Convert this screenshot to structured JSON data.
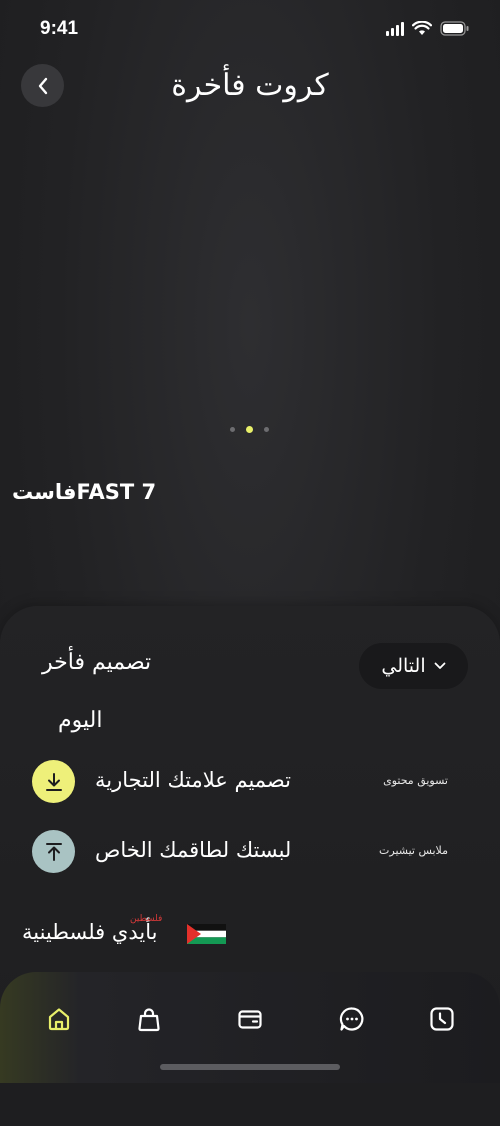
{
  "status_bar": {
    "time": "9:41"
  },
  "header": {
    "title": "كروت فأخرة"
  },
  "carousel": {
    "car_name": "فاستFAST 7"
  },
  "sheet": {
    "title": "تصميم فأخر",
    "next_label": "التالي",
    "date_label": "اليوم",
    "rows": [
      {
        "label": "تصميم علامتك التجارية",
        "category": "تسويق محتوى",
        "icon": "download-icon",
        "icon_bg": "#eef07a"
      },
      {
        "label": "لبستك لطاقمك الخاص",
        "category": "ملابس تيشيرت",
        "icon": "upload-icon",
        "icon_bg": "#a9c3c3"
      }
    ],
    "footer_text": "بأيدي فلسطينية",
    "footer_tag": "فلسطين"
  },
  "nav": {
    "items": [
      "home-icon",
      "bag-icon",
      "wallet-icon",
      "chat-icon",
      "clock-icon"
    ],
    "active": "home-icon"
  },
  "colors": {
    "accent": "#e8f06a",
    "background": "#222224"
  }
}
